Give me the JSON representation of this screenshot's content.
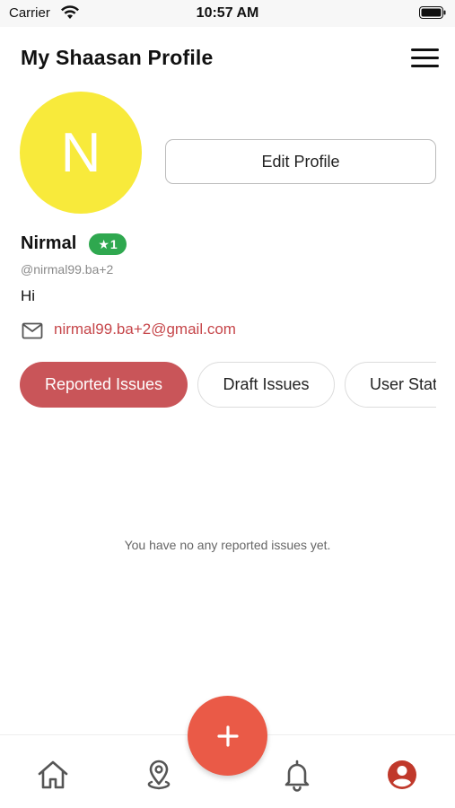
{
  "status_bar": {
    "carrier": "Carrier",
    "time": "10:57 AM"
  },
  "header": {
    "title": "My Shaasan Profile",
    "menu_icon": "hamburger-menu-icon"
  },
  "profile": {
    "avatar_initial": "N",
    "avatar_color": "#f8ea3b",
    "edit_button_label": "Edit Profile",
    "name": "Nirmal",
    "rank_badge": {
      "star": "★",
      "value": "1",
      "color": "#2fa84f"
    },
    "handle": "@nirmal99.ba+2",
    "bio": "Hi",
    "email": "nirmal99.ba+2@gmail.com",
    "email_color": "#c6464a"
  },
  "tabs": [
    {
      "label": "Reported Issues",
      "active": true
    },
    {
      "label": "Draft Issues",
      "active": false
    },
    {
      "label": "User Stat",
      "active": false
    }
  ],
  "empty_state": {
    "message": "You have no any reported issues yet."
  },
  "bottom_nav": {
    "items": [
      {
        "icon": "home-icon",
        "active": false
      },
      {
        "icon": "map-pin-icon",
        "active": false
      },
      {
        "icon": "bell-icon",
        "active": false
      },
      {
        "icon": "account-icon",
        "active": true
      }
    ],
    "fab_icon": "plus-icon",
    "fab_color": "#ea5a47",
    "active_color": "#c0392b"
  }
}
